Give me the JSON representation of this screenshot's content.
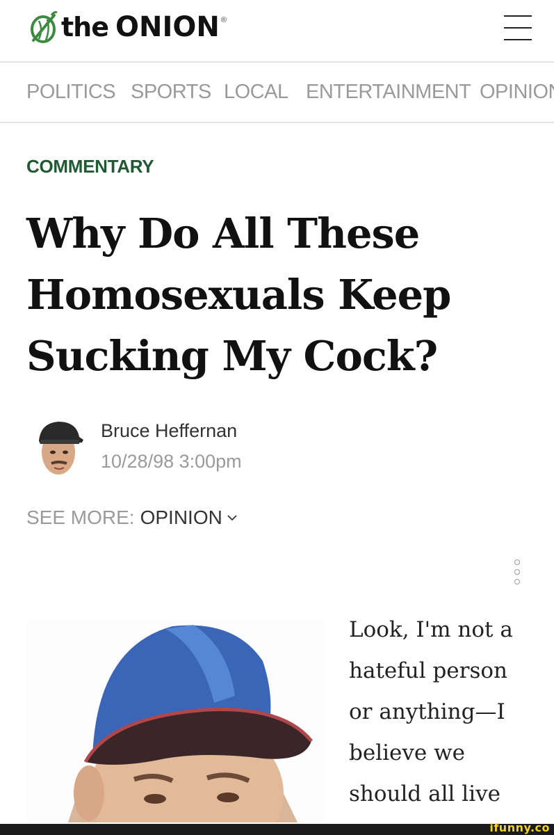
{
  "header": {
    "logo_the": "the",
    "logo_onion": "ONION",
    "logo_registered": "®"
  },
  "nav": {
    "items": [
      {
        "label": "POLITICS"
      },
      {
        "label": "SPORTS"
      },
      {
        "label": "LOCAL"
      },
      {
        "label": "ENTERTAINMENT"
      },
      {
        "label": "OPINION"
      }
    ]
  },
  "article": {
    "section": "COMMENTARY",
    "title_lines": [
      "Why Do All These",
      "Homosexuals Keep",
      "Sucking My Cock?"
    ],
    "author": "Bruce Heffernan",
    "date": "10/28/98 3:00pm",
    "see_more_label": "SEE MORE:",
    "see_more_link": "OPINION",
    "body_lines": [
      "Look, I'm not a",
      "hateful person",
      "or anything—I",
      "believe we",
      "should all live"
    ]
  },
  "icons": {
    "logo": "onion-logo-icon",
    "menu": "hamburger-menu-icon",
    "chevron": "chevron-down-icon",
    "more": "vertical-dots-icon"
  },
  "colors": {
    "section_green": "#1f5a32",
    "logo_green": "#3a8a3f",
    "nav_gray": "#9a9a9a",
    "watermark_yellow": "#f7d21a"
  },
  "watermark": "ifunny.co"
}
